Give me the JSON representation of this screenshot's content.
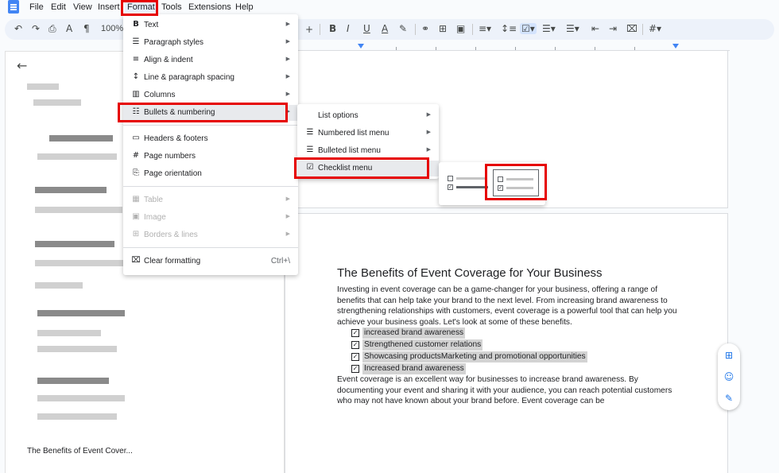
{
  "menubar": {
    "items": [
      "File",
      "Edit",
      "View",
      "Insert",
      "Format",
      "Tools",
      "Extensions",
      "Help"
    ]
  },
  "toolbar": {
    "zoom": "100%",
    "undo_icon": "undo-icon",
    "redo_icon": "redo-icon",
    "print_icon": "print-icon",
    "spellcheck_icon": "spellcheck-icon",
    "paint_format_icon": "paint-format-icon"
  },
  "left_panel": {
    "outline_title": "The Benefits of Event Cover..."
  },
  "format_menu": {
    "items": [
      {
        "icon": "B",
        "label": "Text",
        "submenu": true,
        "disabled": false
      },
      {
        "icon": "☰",
        "label": "Paragraph styles",
        "submenu": true,
        "disabled": false
      },
      {
        "icon": "≡",
        "label": "Align & indent",
        "submenu": true,
        "disabled": false
      },
      {
        "icon": "↕",
        "label": "Line & paragraph spacing",
        "submenu": true,
        "disabled": false
      },
      {
        "icon": "▥",
        "label": "Columns",
        "submenu": true,
        "disabled": false
      },
      {
        "icon": "☷",
        "label": "Bullets & numbering",
        "submenu": true,
        "disabled": false
      },
      {
        "icon": "▭",
        "label": "Headers & footers",
        "submenu": false,
        "disabled": false
      },
      {
        "icon": "#",
        "label": "Page numbers",
        "submenu": false,
        "disabled": false
      },
      {
        "icon": "⎘",
        "label": "Page orientation",
        "submenu": false,
        "disabled": false
      },
      {
        "icon": "▦",
        "label": "Table",
        "submenu": true,
        "disabled": true
      },
      {
        "icon": "▣",
        "label": "Image",
        "submenu": true,
        "disabled": true
      },
      {
        "icon": "⊞",
        "label": "Borders & lines",
        "submenu": true,
        "disabled": true
      },
      {
        "icon": "⌧",
        "label": "Clear formatting",
        "shortcut": "Ctrl+\\",
        "submenu": false,
        "disabled": false
      }
    ]
  },
  "bullets_menu": {
    "items": [
      {
        "icon": "",
        "label": "List options"
      },
      {
        "icon": "☰",
        "label": "Numbered list menu"
      },
      {
        "icon": "☰",
        "label": "Bulleted list menu"
      },
      {
        "icon": "☑",
        "label": "Checklist menu"
      }
    ]
  },
  "document": {
    "title": "The Benefits of Event Coverage for Your Business",
    "para1": "Investing in event coverage can be a game-changer for your business, offering a range of benefits that can help take your brand to the next level. From increasing brand awareness to strengthening relationships with customers, event coverage is a powerful tool that can help you achieve your business goals. Let's look at some of these benefits.",
    "checklist": [
      "increased brand awareness",
      "Strengthened customer relations",
      "Showcasing productsMarketing and promotional opportunities",
      "Increased brand awareness"
    ],
    "para2": "Event coverage is an excellent way for businesses to increase brand awareness. By documenting your event and sharing it with your audience, you can reach potential customers who may not have known about your brand before. Event coverage can be"
  },
  "colors": {
    "annotation": "#e60000",
    "accent": "#1a73e8",
    "highlight": "#d3d3d3"
  }
}
